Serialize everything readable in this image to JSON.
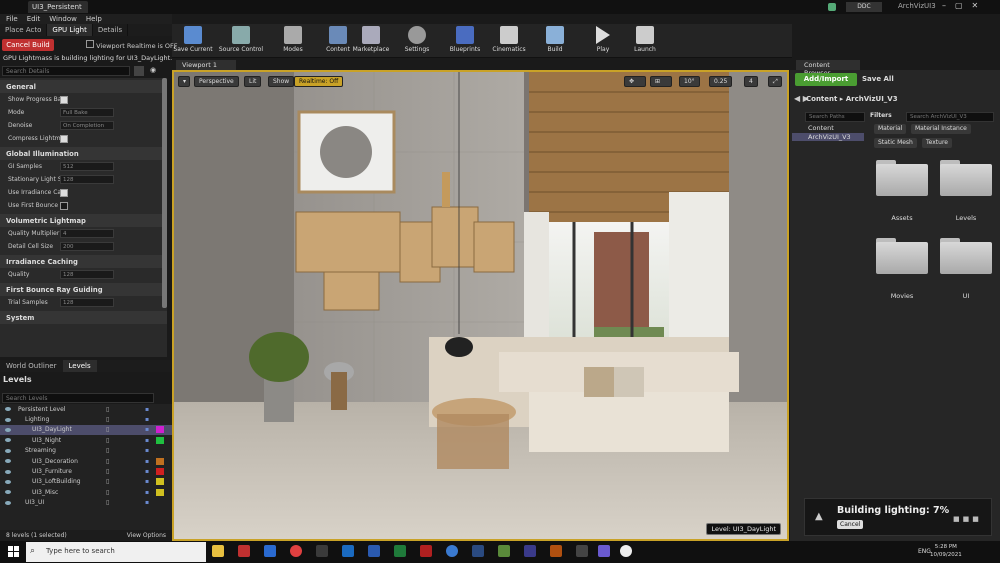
{
  "window": {
    "tab_title": "UI3_Persistent",
    "project": "ArchVizUI3",
    "ddc": "DDC"
  },
  "menu": [
    "File",
    "Edit",
    "Window",
    "Help"
  ],
  "toolbar": [
    "Save Current",
    "Source Control",
    "Modes",
    "Content",
    "Marketplace",
    "Settings",
    "Blueprints",
    "Cinematics",
    "Build",
    "Play",
    "Launch"
  ],
  "left_tabs": [
    "Place Acto",
    "GPU Light",
    "Details"
  ],
  "details": {
    "cancel_build": "Cancel Build",
    "viewport_realtime": "Viewport Realtime is OFF",
    "message": "GPU Lightmass is building lighting for UI3_DayLight.",
    "search_placeholder": "Search Details",
    "sections": [
      {
        "title": "General",
        "rows": [
          {
            "label": "Show Progress Ba",
            "type": "check",
            "checked": true
          },
          {
            "label": "Mode",
            "type": "select",
            "value": "Full Bake"
          },
          {
            "label": "Denoise",
            "type": "select",
            "value": "On Completion"
          },
          {
            "label": "Compress Lightmu",
            "type": "check",
            "checked": true
          }
        ]
      },
      {
        "title": "Global Illumination",
        "rows": [
          {
            "label": "GI Samples",
            "type": "field",
            "value": "512"
          },
          {
            "label": "Stationary Light S",
            "type": "field",
            "value": "128"
          },
          {
            "label": "Use Irradiance Car",
            "type": "check",
            "checked": true
          },
          {
            "label": "Use First Bounce I",
            "type": "check",
            "checked": false
          }
        ]
      },
      {
        "title": "Volumetric Lightmap",
        "rows": [
          {
            "label": "Quality Multiplier",
            "type": "field",
            "value": "4"
          },
          {
            "label": "Detail Cell Size",
            "type": "field",
            "value": "200"
          }
        ]
      },
      {
        "title": "Irradiance Caching",
        "rows": [
          {
            "label": "Quality",
            "type": "field",
            "value": "128"
          }
        ]
      },
      {
        "title": "First Bounce Ray Guiding",
        "rows": [
          {
            "label": "Trial Samples",
            "type": "field",
            "value": "128"
          }
        ]
      },
      {
        "title": "System",
        "rows": []
      }
    ]
  },
  "bottom_left_tabs": [
    "World Outliner",
    "Levels"
  ],
  "levels": {
    "header": "Levels",
    "search_placeholder": "Search Levels",
    "items": [
      {
        "name": "Persistent Level",
        "indent": 0,
        "color": ""
      },
      {
        "name": "Lighting",
        "indent": 1,
        "color": ""
      },
      {
        "name": "UI3_DayLight",
        "indent": 2,
        "color": "#d020d0",
        "selected": true
      },
      {
        "name": "UI3_Night",
        "indent": 2,
        "color": "#20c040"
      },
      {
        "name": "Streaming",
        "indent": 1,
        "color": ""
      },
      {
        "name": "UI3_Decoration",
        "indent": 2,
        "color": "#c07020"
      },
      {
        "name": "UI3_Furniture",
        "indent": 2,
        "color": "#d02020"
      },
      {
        "name": "UI3_LoftBuilding",
        "indent": 2,
        "color": "#d0c020"
      },
      {
        "name": "UI3_Misc",
        "indent": 2,
        "color": "#d0c020"
      },
      {
        "name": "UI3_UI",
        "indent": 1,
        "color": ""
      }
    ],
    "footer": "8 levels (1 selected)",
    "view_options": "View Options"
  },
  "viewport": {
    "tab": "Viewport 1",
    "buttons": [
      "Perspective",
      "Lit",
      "Show",
      "Realtime: Off"
    ],
    "snap": [
      "10°",
      "0.25",
      "4"
    ],
    "level_badge": "Level:  UI3_DayLight"
  },
  "content_browser": {
    "tab": "Content Browser",
    "add_import": "Add/Import",
    "save_all": "Save All",
    "breadcrumb": [
      "Content",
      "ArchVizUI_V3"
    ],
    "path_search": "Search Paths",
    "filters": "Filters",
    "asset_search": "Search ArchVizUI_V3",
    "tree": [
      "Content",
      "ArchVizUI_V3"
    ],
    "chips": [
      "Material",
      "Material Instance",
      "Static Mesh",
      "Texture"
    ],
    "folders": [
      "Assets",
      "Levels",
      "Movies",
      "UI"
    ]
  },
  "toast": {
    "text": "Building lighting:  7%",
    "cancel": "Cancel"
  },
  "taskbar": {
    "search": "Type here to search",
    "lang": "ENG",
    "time": "5:28 PM",
    "date": "10/09/2021"
  }
}
